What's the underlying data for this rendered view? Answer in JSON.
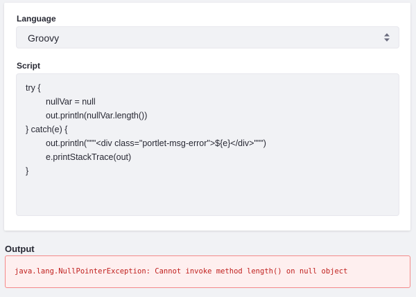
{
  "form": {
    "language_label": "Language",
    "language_value": "Groovy",
    "script_label": "Script",
    "script_lines": [
      "try {",
      "nullVar = null",
      "out.println(nullVar.length())",
      "} catch(e) {",
      "out.println(\"\"\"<div class=\"portlet-msg-error\">${e}</div>\"\"\")",
      "e.printStackTrace(out)",
      "}"
    ]
  },
  "output": {
    "title": "Output",
    "message": "java.lang.NullPointerException: Cannot invoke method length() on null object"
  },
  "icons": {
    "select_arrows": "sort-arrows-icon"
  },
  "colors": {
    "error_text": "#c0201e",
    "error_bg": "#feefef",
    "error_border": "#f48989"
  }
}
